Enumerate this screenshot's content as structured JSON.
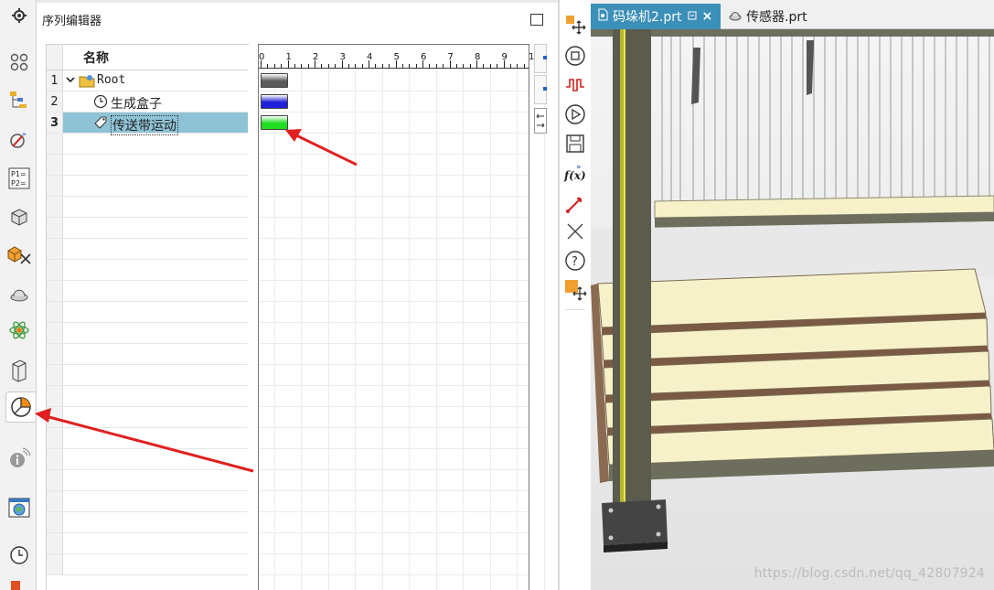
{
  "panel": {
    "title": "序列编辑器",
    "column_header": "名称"
  },
  "rows": [
    {
      "num": "1",
      "label": "Root",
      "icon": "root-folder-icon",
      "expanded": true
    },
    {
      "num": "2",
      "label": "生成盒子",
      "icon": "clock-icon"
    },
    {
      "num": "3",
      "label": "传送带运动",
      "icon": "tag-icon",
      "selected": true
    }
  ],
  "ruler_ticks": [
    "0",
    "1",
    "2",
    "3",
    "4",
    "5",
    "6",
    "7",
    "8",
    "9",
    "1"
  ],
  "bars": [
    {
      "name": "root-bar",
      "color": "#5a5a5a"
    },
    {
      "name": "create-box-bar",
      "color": "#2020d8"
    },
    {
      "name": "conveyor-bar",
      "color": "#22dd22"
    }
  ],
  "tabs": [
    {
      "label": "码垛机2.prt",
      "active": true,
      "icon": "part-file-icon"
    },
    {
      "label": "传感器.prt",
      "active": false,
      "icon": "part-3d-icon"
    }
  ],
  "left_toolbar_icons": [
    "gear-icon",
    "assembly-navigator-icon",
    "constraint-navigator-icon",
    "part-navigator-icon",
    "expression-icon",
    "physics-navigator-icon",
    "mechanism-icon",
    "sensor-icon",
    "runtime-inspector-icon",
    "system-navigator-icon",
    "sequence-editor-icon",
    "information-icon",
    "web-browser-icon",
    "history-icon"
  ],
  "vertical_toolbar_icons": [
    "move-icon",
    "stop-icon",
    "signal-icon",
    "play-icon",
    "save-icon",
    "formula-icon",
    "probe-icon",
    "close-x-icon",
    "help-icon",
    "drag-object-icon"
  ],
  "colors": {
    "selection": "#8ec3d6",
    "tab_active": "#3c8fb8",
    "arrow": "#e02020",
    "frame": "#5b5b4e",
    "pallet": "#f6f1c9"
  },
  "watermark": "https://blog.csdn.net/qq_42807924"
}
